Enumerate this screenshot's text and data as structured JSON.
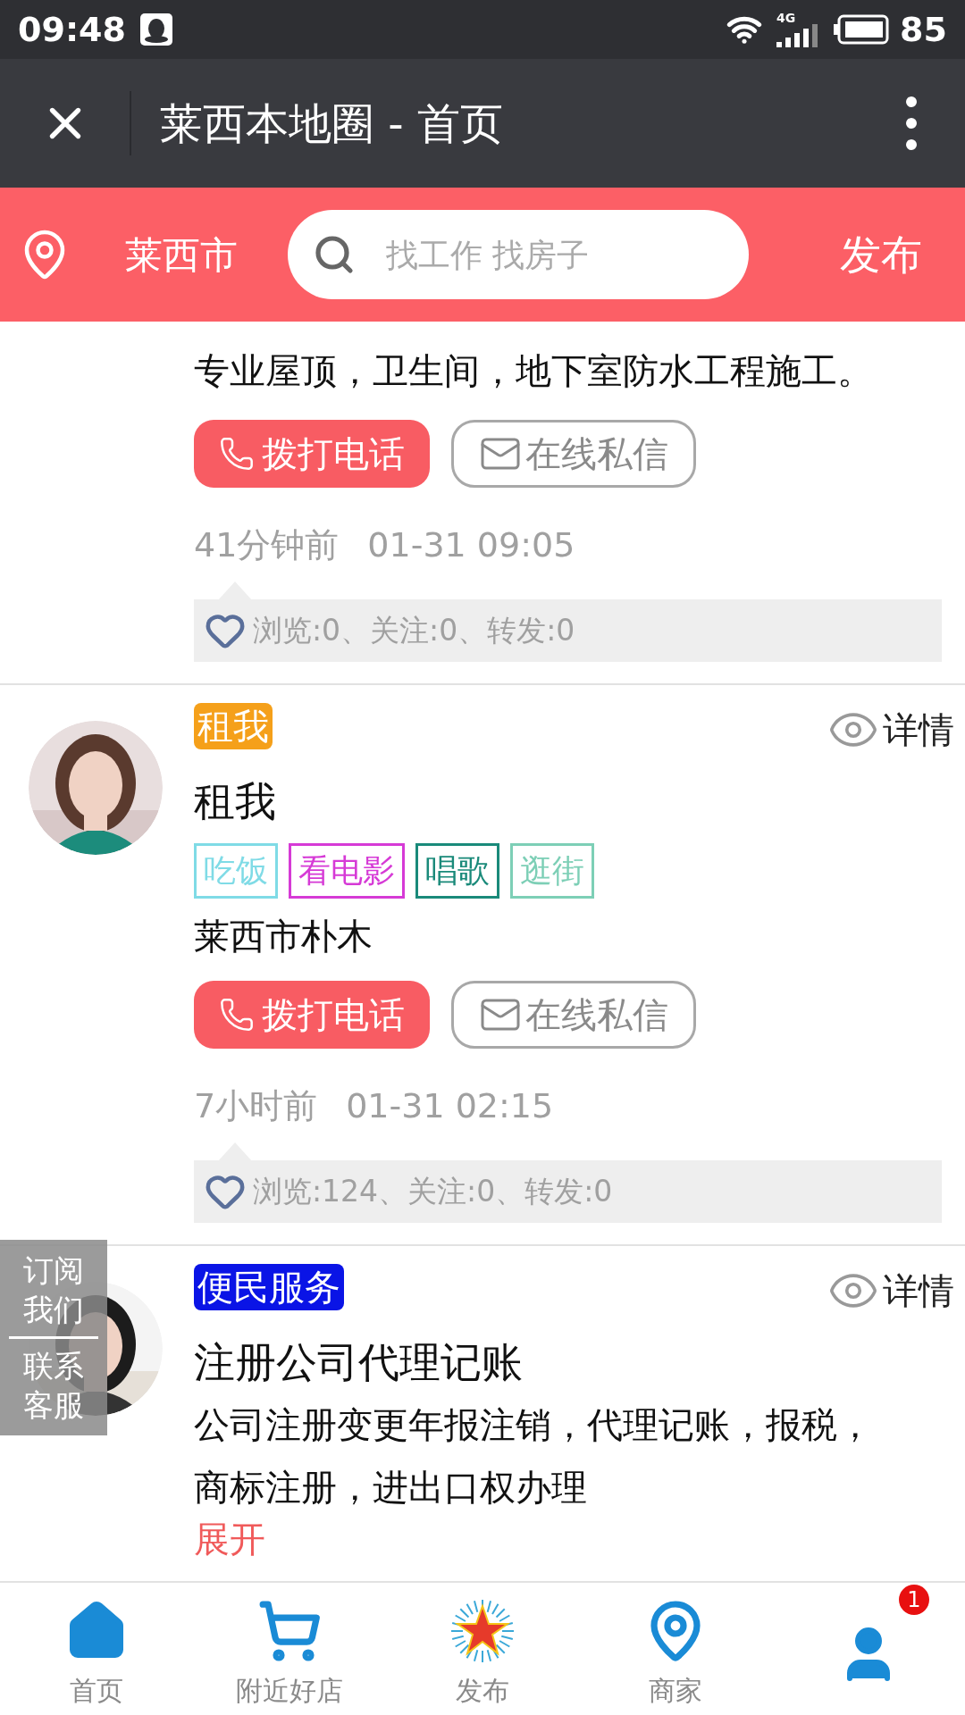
{
  "status_bar": {
    "time": "09:48",
    "network": "4G",
    "battery": "85"
  },
  "title_bar": {
    "title": "莱西本地圈 - 首页"
  },
  "search_bar": {
    "city": "莱西市",
    "placeholder": "找工作 找房子",
    "action": "发布"
  },
  "posts": [
    {
      "description": "专业屋顶，卫生间，地下室防水工程施工。",
      "call_label": "拨打电话",
      "message_label": "在线私信",
      "ago": "41分钟前",
      "date": "01-31 09:05",
      "stats": "浏览:0、关注:0、转发:0"
    },
    {
      "avatar": {
        "kind": "picture"
      },
      "category": {
        "text": "租我",
        "color": "#f5a01a"
      },
      "detail_label": "详情",
      "title": "租我",
      "tags": [
        {
          "text": "吃饭",
          "color": "#7fdbe6"
        },
        {
          "text": "看电影",
          "color": "#d63ad6"
        },
        {
          "text": "唱歌",
          "color": "#1a8a7a"
        },
        {
          "text": "逛街",
          "color": "#7dcfb6"
        }
      ],
      "address": "莱西市朴木",
      "call_label": "拨打电话",
      "message_label": "在线私信",
      "ago": "7小时前",
      "date": "01-31 02:15",
      "stats": "浏览:124、关注:0、转发:0"
    },
    {
      "avatar": {
        "kind": "picture"
      },
      "category": {
        "text": "便民服务",
        "color": "#0a14e6"
      },
      "detail_label": "详情",
      "title": "注册公司代理记账",
      "description": "公司注册变更年报注销，代理记账，报税，商标注册，进出口权办理",
      "expand_label": "展开"
    }
  ],
  "floating_panel": {
    "subscribe": "订阅我们",
    "contact": "联系客服"
  },
  "bottom_nav": [
    {
      "kind": "home",
      "label": "首页"
    },
    {
      "kind": "cart",
      "label": "附近好店"
    },
    {
      "kind": "star",
      "label": "发布"
    },
    {
      "kind": "pin",
      "label": "商家"
    },
    {
      "kind": "user",
      "badge": "1"
    }
  ]
}
